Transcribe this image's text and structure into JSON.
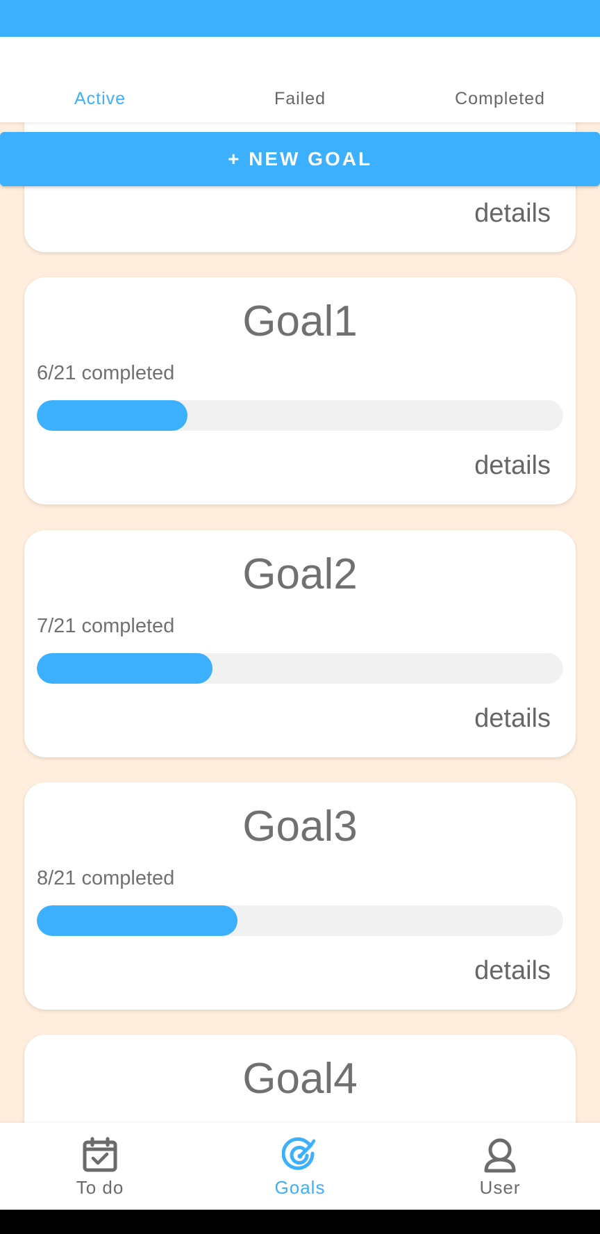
{
  "tabs": [
    {
      "label": "Active",
      "active": true
    },
    {
      "label": "Failed",
      "active": false
    },
    {
      "label": "Completed",
      "active": false
    }
  ],
  "new_goal_label": "+ NEW GOAL",
  "details_label": "details",
  "goals": [
    {
      "title": "Goal1",
      "progress_text": "6/21 completed",
      "done": 6,
      "total": 21
    },
    {
      "title": "Goal2",
      "progress_text": "7/21 completed",
      "done": 7,
      "total": 21
    },
    {
      "title": "Goal3",
      "progress_text": "8/21 completed",
      "done": 8,
      "total": 21
    },
    {
      "title": "Goal4"
    }
  ],
  "bottom_nav": [
    {
      "label": "To do",
      "icon": "calendar-check-icon",
      "active": false
    },
    {
      "label": "Goals",
      "icon": "target-icon",
      "active": true
    },
    {
      "label": "User",
      "icon": "user-icon",
      "active": false
    }
  ],
  "colors": {
    "accent": "#3db0fd",
    "background": "#ffeedd",
    "card": "#ffffff",
    "track": "#f1f1f1",
    "text": "#707070"
  }
}
